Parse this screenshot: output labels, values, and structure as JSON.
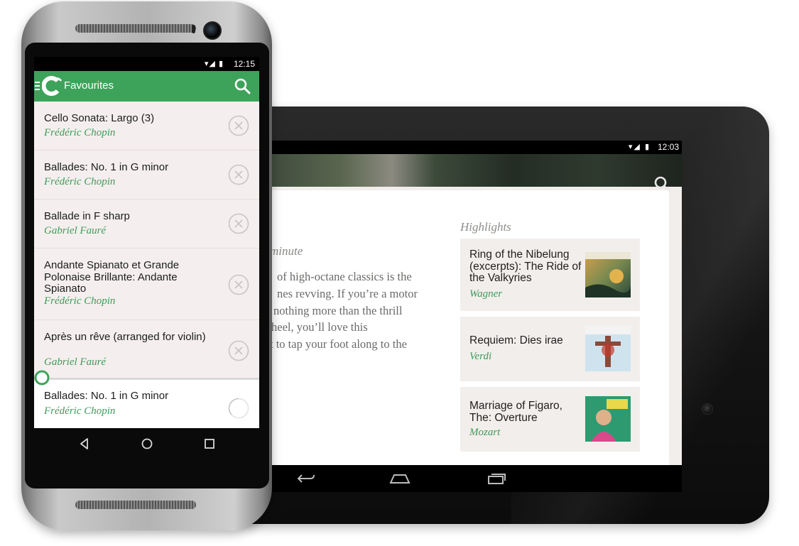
{
  "tablet": {
    "status": {
      "icons": "▾◢ ▮",
      "time": "12:03"
    },
    "subtitle": "minute",
    "body_lines": [
      "of high-octane classics is the",
      "nes revving. If you’re a motor",
      "nothing more than the thrill",
      "heel, you’ll love this",
      "t to tap your foot along to the"
    ],
    "highlights_label": "Highlights",
    "highlights": [
      {
        "title": "Ring of the Nibelung (excerpts): The Ride of the Valkyries",
        "composer": "Wagner"
      },
      {
        "title": "Requiem: Dies irae",
        "composer": "Verdi"
      },
      {
        "title": "Marriage of Figaro, The: Overture",
        "composer": "Mozart"
      }
    ]
  },
  "phone": {
    "status": {
      "icons": "▾◢ ▮",
      "time": "12:15"
    },
    "appbar_title": "Favourites",
    "items": [
      {
        "title": "Cello Sonata: Largo (3)",
        "composer": "Frédéric Chopin"
      },
      {
        "title": "Ballades: No. 1 in G minor",
        "composer": "Frédéric Chopin"
      },
      {
        "title": "Ballade in F sharp",
        "composer": "Gabriel Fauré"
      },
      {
        "title": "Andante Spianato et Grande Polonaise Brillante: Andante Spianato",
        "composer": "Frédéric Chopin"
      },
      {
        "title": "Après un rêve (arranged for violin)",
        "composer": "Gabriel Fauré"
      },
      {
        "title": "Ballades: No. 1 in G minor",
        "composer": "Frédéric Chopin"
      }
    ]
  },
  "colors": {
    "accent_green": "#3ea35a",
    "list_bg": "#f4efee"
  }
}
